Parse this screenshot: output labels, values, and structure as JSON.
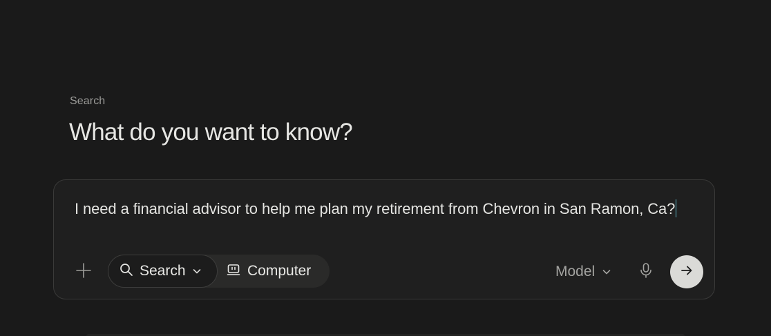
{
  "page": {
    "section_label": "Search",
    "heading": "What do you want to know?"
  },
  "composer": {
    "query_text": "I need a financial advisor to help me plan my retirement from Chevron in San Ramon, Ca?",
    "toolbar": {
      "attach_icon": "plus-icon",
      "modes": [
        {
          "label": "Search",
          "icon": "search-icon",
          "selected": true,
          "has_dropdown": true
        },
        {
          "label": "Computer",
          "icon": "computer-icon",
          "selected": false
        }
      ],
      "model_label": "Model",
      "mic_icon": "microphone-icon",
      "submit_icon": "arrow-right-icon"
    }
  },
  "colors": {
    "background": "#1a1a1a",
    "composer_bg": "#1f1f1f",
    "composer_border": "#3a3a39",
    "caret": "#5fb7c9",
    "submit_bg": "#dadad7"
  }
}
